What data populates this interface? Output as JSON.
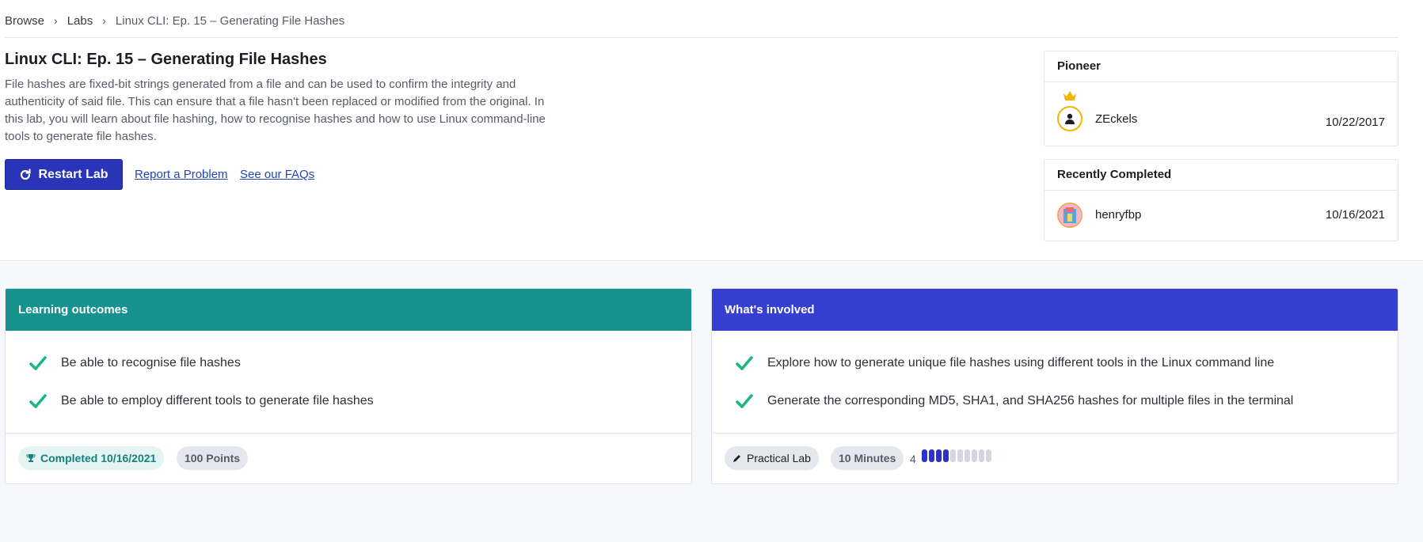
{
  "breadcrumb": {
    "items": [
      "Browse",
      "Labs"
    ],
    "current": "Linux CLI: Ep. 15 – Generating File Hashes",
    "separator": "›"
  },
  "lab": {
    "title": "Linux CLI: Ep. 15 – Generating File Hashes",
    "description": "File hashes are fixed-bit strings generated from a file and can be used to confirm the integrity and authenticity of said file. This can ensure that a file hasn't been replaced or modified from the original. In this lab, you will learn about file hashing, how to recognise hashes and how to use Linux command-line tools to generate file hashes.",
    "restart_label": "Restart Lab",
    "report_label": "Report a Problem",
    "faq_label": "See our FAQs"
  },
  "pioneer": {
    "heading": "Pioneer",
    "name": "ZEckels",
    "date": "10/22/2017"
  },
  "recent": {
    "heading": "Recently Completed",
    "name": "henryfbp",
    "date": "10/16/2021"
  },
  "outcomes": {
    "heading": "Learning outcomes",
    "items": [
      "Be able to recognise file hashes",
      "Be able to employ different tools to generate file hashes"
    ],
    "completed_label": "Completed 10/16/2021",
    "points_label": "100 Points"
  },
  "involved": {
    "heading": "What's involved",
    "items": [
      "Explore how to generate unique file hashes using different tools in the Linux command line",
      "Generate the corresponding MD5, SHA1, and SHA256 hashes for multiple files in the terminal"
    ],
    "type_label": "Practical Lab",
    "duration_label": "10 Minutes",
    "difficulty": "4",
    "difficulty_level": 4,
    "difficulty_max": 10
  },
  "colors": {
    "primary": "#2a34b8",
    "outcomes_header": "#17928e",
    "involved_header": "#3540d2",
    "check": "#19b58a",
    "crown": "#f2b500"
  },
  "icons": {
    "restart": "restart-icon",
    "crown": "crown-icon",
    "user": "user-icon",
    "check": "check-icon",
    "trophy": "trophy-icon",
    "pencil": "pencil-icon"
  }
}
